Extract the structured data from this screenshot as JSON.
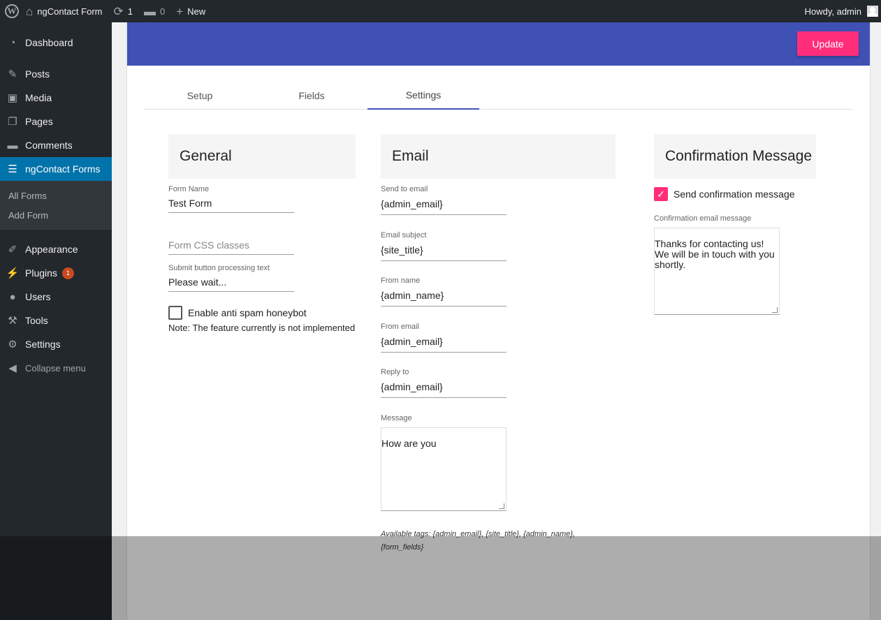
{
  "adminbar": {
    "site_name": "ngContact Form",
    "updates_count": "1",
    "comments_count": "0",
    "new_label": "New",
    "greeting": "Howdy, admin"
  },
  "sidebar": {
    "items": [
      {
        "label": "Dashboard",
        "icon": "dashboard-icon"
      },
      {
        "label": "Posts",
        "icon": "pin-icon"
      },
      {
        "label": "Media",
        "icon": "media-icon"
      },
      {
        "label": "Pages",
        "icon": "pages-icon"
      },
      {
        "label": "Comments",
        "icon": "comment-icon"
      },
      {
        "label": "ngContact Forms",
        "icon": "forms-icon"
      },
      {
        "label": "Appearance",
        "icon": "brush-icon"
      },
      {
        "label": "Plugins",
        "icon": "plugin-icon",
        "badge": "1"
      },
      {
        "label": "Users",
        "icon": "user-icon"
      },
      {
        "label": "Tools",
        "icon": "wrench-icon"
      },
      {
        "label": "Settings",
        "icon": "settings-icon"
      }
    ],
    "submenu": [
      "All Forms",
      "Add Form"
    ],
    "collapse_label": "Collapse menu"
  },
  "header": {
    "update_label": "Update",
    "color": "#3f51b5",
    "button_color": "#ff2d7a"
  },
  "tabs": [
    "Setup",
    "Fields",
    "Settings"
  ],
  "active_tab": "Settings",
  "general": {
    "title": "General",
    "form_name_label": "Form Name",
    "form_name_value": "Test Form",
    "css_placeholder": "Form CSS classes",
    "processing_label": "Submit button processing text",
    "processing_value": "Please wait...",
    "honeypot_label": "Enable anti spam honeybot",
    "honeypot_checked": false,
    "note": "Note: The feature currently is not implemented"
  },
  "email": {
    "title": "Email",
    "fields": [
      {
        "label": "Send to email",
        "value": "{admin_email}"
      },
      {
        "label": "Email subject",
        "value": "{site_title}"
      },
      {
        "label": "From name",
        "value": "{admin_name}"
      },
      {
        "label": "From email",
        "value": "{admin_email}"
      },
      {
        "label": "Reply to",
        "value": "{admin_email}"
      }
    ],
    "message_label": "Message",
    "message_value": "How are you",
    "tags_text": "Available tags: {admin_email}, {site_title}, {admin_name}, {form_fields}"
  },
  "confirmation": {
    "title": "Confirmation Message",
    "send_label": "Send confirmation message",
    "send_checked": true,
    "message_label": "Confirmation email message",
    "message_value": "Thanks for contacting us!\nWe will be in touch with you shortly."
  }
}
